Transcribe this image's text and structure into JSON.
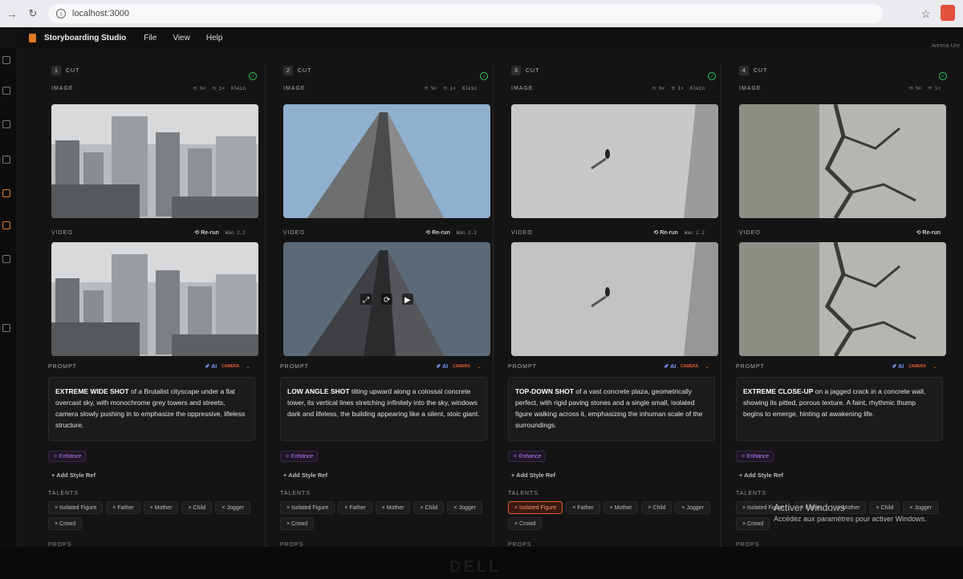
{
  "browser": {
    "url": "localhost:3000"
  },
  "app": {
    "title": "Storyboarding Studio",
    "menu": [
      "File",
      "View",
      "Help"
    ],
    "user": "Arinma Ure"
  },
  "cards": [
    {
      "num": "1",
      "label": "CUT",
      "image_label": "IMAGE",
      "image_meta": [
        "⟲ ¾×",
        "⟲ 1×",
        "Klein"
      ],
      "video_label": "VIDEO",
      "rerun": "⟲ Re-run",
      "video_model": "Wan 2.2",
      "prompt_label": "PROMPT",
      "ai": "✐ AI",
      "camera": "CAMERA",
      "prompt_lead": "EXTREME WIDE SHOT",
      "prompt_rest": " of a Brutalist cityscape under a flat overcast sky, with monochrome grey towers and streets, camera slowly pushing in to emphasize the oppressive, lifeless structure.",
      "enhance": "✧ Enhance",
      "style_ref": "+ Add Style Ref",
      "talents_label": "TALENTS",
      "talents": [
        "× Isolated Figure",
        "× Father",
        "× Mother",
        "× Child",
        "× Jogger",
        "× Crowd"
      ],
      "selected": "",
      "props_label": "PROPS"
    },
    {
      "num": "2",
      "label": "CUT",
      "image_label": "IMAGE",
      "image_meta": [
        "⟲ ¾×",
        "⟲ 1×",
        "Klein"
      ],
      "video_label": "VIDEO",
      "rerun": "⟲ Re-run",
      "video_model": "Wan 2.2",
      "prompt_label": "PROMPT",
      "ai": "✐ AI",
      "camera": "CAMERA",
      "prompt_lead": "LOW ANGLE SHOT",
      "prompt_rest": " tilting upward along a colossal concrete tower, its vertical lines stretching infinitely into the sky, windows dark and lifeless, the building appearing like a silent, stoic giant.",
      "enhance": "✧ Enhance",
      "style_ref": "+ Add Style Ref",
      "talents_label": "TALENTS",
      "talents": [
        "× Isolated Figure",
        "× Father",
        "× Mother",
        "× Child",
        "× Jogger",
        "× Crowd"
      ],
      "selected": "",
      "props_label": "PROPS"
    },
    {
      "num": "3",
      "label": "CUT",
      "image_label": "IMAGE",
      "image_meta": [
        "⟲ ¾×",
        "⟲ 1×",
        "Klein"
      ],
      "video_label": "VIDEO",
      "rerun": "⟲ Re-run",
      "video_model": "Wan 2.2",
      "prompt_label": "PROMPT",
      "ai": "✐ AI",
      "camera": "CAMERA",
      "prompt_lead": "TOP-DOWN SHOT",
      "prompt_rest": " of a vast concrete plaza, geometrically perfect, with rigid paving stones and a single small, isolated figure walking across it, emphasizing the inhuman scale of the surroundings.",
      "enhance": "✧ Enhance",
      "style_ref": "+ Add Style Ref",
      "talents_label": "TALENTS",
      "talents": [
        "× Isolated Figure",
        "× Father",
        "× Mother",
        "× Child",
        "× Jogger",
        "× Crowd"
      ],
      "selected": "× Isolated Figure",
      "props_label": "PROPS"
    },
    {
      "num": "4",
      "label": "CUT",
      "image_label": "IMAGE",
      "image_meta": [
        "⟲ ¾×",
        "⟲ 1×"
      ],
      "video_label": "VIDEO",
      "rerun": "⟲ Re-run",
      "video_model": "",
      "prompt_label": "PROMPT",
      "ai": "✐ AI",
      "camera": "CAMERA",
      "prompt_lead": "EXTREME CLOSE-UP",
      "prompt_rest": " on a jagged crack in a concrete wall, showing its pitted, porous texture. A faint, rhythmic thump begins to emerge, hinting at awakening life.",
      "enhance": "✧ Enhance",
      "style_ref": "+ Add Style Ref",
      "talents_label": "TALENTS",
      "talents": [
        "× Isolated Figure",
        "× Father",
        "× Mother",
        "× Child",
        "× Jogger",
        "× Crowd"
      ],
      "selected": "",
      "props_label": "PROPS"
    }
  ],
  "windows_notice": {
    "title": "Activer Windows",
    "subtitle": "Accédez aux paramètres pour activer Windows."
  },
  "colors": {
    "accent": "#e37a26",
    "ok": "#36c75a",
    "ai": "#7b9bff",
    "enhance": "#c27bff",
    "selected": "#e35a2a"
  }
}
